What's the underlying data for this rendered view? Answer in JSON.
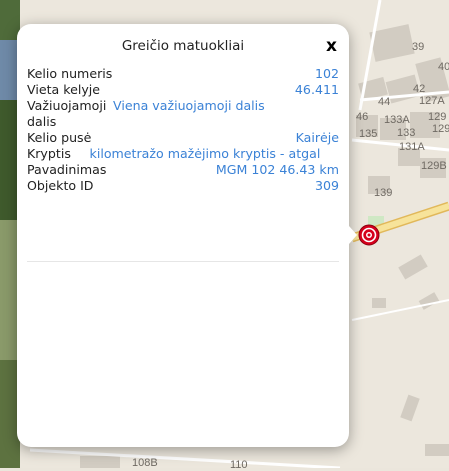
{
  "map": {
    "house_numbers": [
      "39",
      "40",
      "42",
      "127A",
      "44",
      "46",
      "133A",
      "129",
      "135",
      "133",
      "129",
      "131A",
      "129B",
      "139",
      "108B",
      "110"
    ]
  },
  "popup": {
    "title": "Greičio matuokliai",
    "close_label": "x",
    "rows": [
      {
        "label": "Kelio numeris",
        "value": "102"
      },
      {
        "label": "Vieta kelyje",
        "value": "46.411"
      },
      {
        "label": "Važiuojamoji dalis",
        "value": "Viena važiuojamoji dalis"
      },
      {
        "label": "Kelio pusė",
        "value": "Kairėje"
      },
      {
        "label": "Kryptis",
        "value": "kilometražo mažėjimo kryptis - atgal"
      },
      {
        "label": "Pavadinimas",
        "value": "MGM 102 46.43 km"
      },
      {
        "label": "Objekto ID",
        "value": "309"
      }
    ]
  },
  "colors": {
    "link": "#3b82d6",
    "road": "#f7e39a",
    "building": "#cfc9bf",
    "marker": "#d6001c"
  },
  "icons": {
    "marker": "speed-camera-marker-icon",
    "close": "close-icon"
  }
}
